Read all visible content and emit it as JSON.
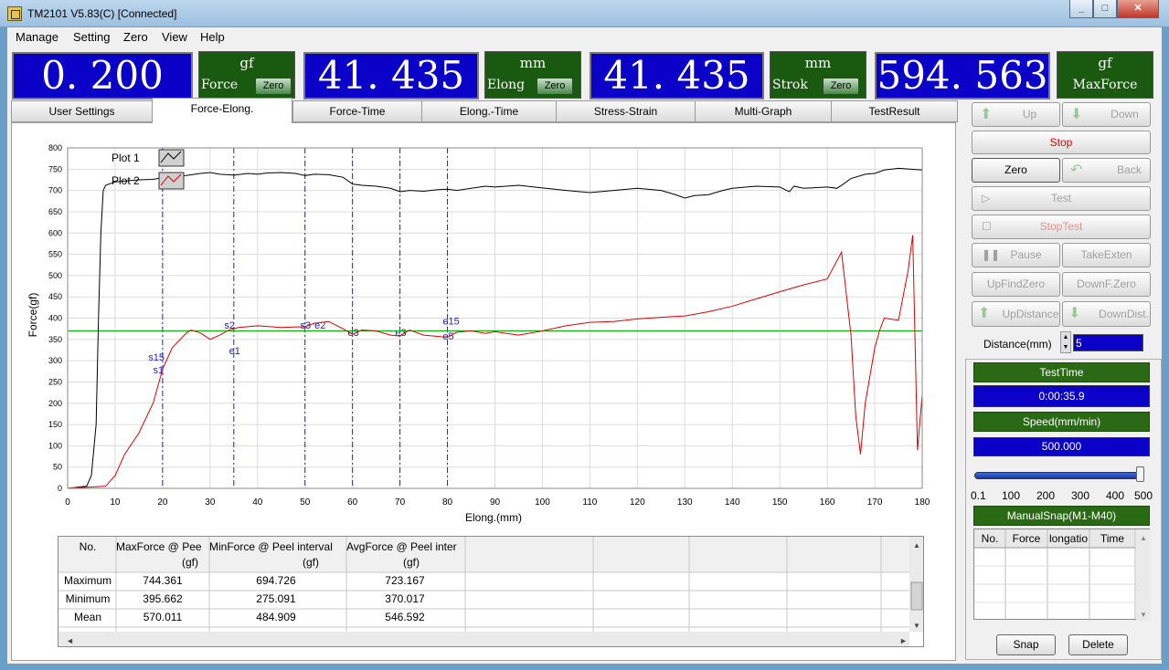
{
  "window": {
    "title": "TM2101  V5.83(C)   [Connected]",
    "min": "_",
    "max": "□",
    "close": "✕"
  },
  "menu": [
    "Manage",
    "Setting",
    "Zero",
    "View",
    "Help"
  ],
  "displays": [
    {
      "value": "0. 200",
      "unit": "gf",
      "label": "Force",
      "zero": "Zero"
    },
    {
      "value": "41. 435",
      "unit": "mm",
      "label": "Elong",
      "zero": "Zero"
    },
    {
      "value": "41. 435",
      "unit": "mm",
      "label": "Strok",
      "zero": "Zero"
    },
    {
      "value": "594. 563",
      "unit": "gf",
      "label": "MaxForce"
    }
  ],
  "tabs": [
    "User Settings",
    "Force-Elong.",
    "Force-Time",
    "Elong.-Time",
    "Stress-Strain",
    "Multi-Graph",
    "TestResult"
  ],
  "active_tab": 1,
  "chart_data": {
    "type": "line",
    "xlabel": "Elong.(mm)",
    "ylabel": "Force(gf)",
    "xlim": [
      0,
      180
    ],
    "ylim": [
      0,
      800
    ],
    "xticks": [
      0,
      10,
      20,
      30,
      40,
      50,
      60,
      70,
      80,
      90,
      100,
      110,
      120,
      130,
      140,
      150,
      160,
      170,
      180
    ],
    "yticks": [
      0,
      50,
      100,
      150,
      200,
      250,
      300,
      350,
      400,
      450,
      500,
      550,
      600,
      650,
      700,
      750,
      800
    ],
    "grid": true,
    "legend": "top-left",
    "series": [
      {
        "name": "Plot 1",
        "color": "#000000",
        "x": [
          0,
          4,
          5,
          6,
          6.5,
          7,
          7.5,
          8,
          9,
          10,
          12,
          15,
          18,
          20,
          22,
          25,
          28,
          30,
          32,
          35,
          38,
          40,
          42,
          45,
          48,
          50,
          52,
          55,
          58,
          60,
          62,
          65,
          68,
          70,
          72,
          75,
          78,
          80,
          82,
          85,
          88,
          90,
          95,
          100,
          105,
          110,
          115,
          120,
          125,
          128,
          130,
          132,
          135,
          138,
          140,
          145,
          150,
          152,
          153,
          155,
          160,
          162,
          163,
          165,
          168,
          170,
          172,
          175,
          180
        ],
        "y": [
          0,
          5,
          30,
          150,
          400,
          600,
          700,
          712,
          716,
          720,
          722,
          725,
          726,
          730,
          734,
          735,
          740,
          742,
          738,
          736,
          740,
          738,
          741,
          742,
          740,
          735,
          738,
          737,
          731,
          715,
          712,
          710,
          705,
          697,
          700,
          698,
          702,
          703,
          700,
          705,
          710,
          708,
          712,
          706,
          700,
          695,
          700,
          705,
          700,
          690,
          682,
          688,
          690,
          700,
          705,
          710,
          708,
          697,
          710,
          705,
          708,
          705,
          712,
          728,
          738,
          740,
          748,
          752,
          748
        ]
      },
      {
        "name": "Plot 2",
        "color": "#e00000",
        "x": [
          0,
          8,
          10,
          12,
          15,
          18,
          20,
          22,
          25,
          26,
          28,
          30,
          32,
          34,
          36,
          38,
          40,
          45,
          50,
          52,
          55,
          58,
          60,
          62,
          65,
          68,
          70,
          72,
          75,
          80,
          82,
          85,
          88,
          90,
          95,
          100,
          105,
          110,
          115,
          120,
          125,
          130,
          135,
          140,
          145,
          150,
          155,
          160,
          163,
          165,
          166,
          167,
          168,
          170,
          171,
          172,
          175,
          177,
          178,
          179,
          180
        ],
        "y": [
          0,
          5,
          30,
          80,
          130,
          200,
          280,
          330,
          365,
          372,
          365,
          350,
          360,
          372,
          378,
          380,
          382,
          378,
          380,
          388,
          392,
          375,
          362,
          372,
          370,
          360,
          358,
          372,
          360,
          355,
          367,
          370,
          364,
          368,
          360,
          370,
          382,
          390,
          392,
          398,
          402,
          405,
          415,
          428,
          445,
          462,
          478,
          492,
          555,
          360,
          170,
          80,
          200,
          330,
          370,
          400,
          395,
          510,
          595,
          90,
          220
        ]
      }
    ],
    "hline": {
      "y": 370,
      "color": "#00b000"
    },
    "vlines": [
      {
        "x": 20,
        "labels": [
          "s15",
          "s1"
        ]
      },
      {
        "x": 35,
        "labels": [
          "s2",
          "e1"
        ]
      },
      {
        "x": 50,
        "labels": [
          "s3",
          "e2"
        ]
      },
      {
        "x": 60,
        "labels": [
          "e3"
        ]
      },
      {
        "x": 70,
        "labels": [
          "e3"
        ]
      },
      {
        "x": 80,
        "labels": [
          "e15",
          "e5"
        ]
      }
    ]
  },
  "results": {
    "headers": [
      {
        "top": "No.",
        "unit": ""
      },
      {
        "top": "MaxForce @ Pee",
        "unit": "(gf)"
      },
      {
        "top": "MinForce @ Peel interval",
        "unit": "(gf)"
      },
      {
        "top": "AvgForce @ Peel inter",
        "unit": "(gf)"
      }
    ],
    "rows": [
      [
        "Maximum",
        "744.361",
        "694.726",
        "723.167"
      ],
      [
        "Minimum",
        "395.662",
        "275.091",
        "370.017"
      ],
      [
        "Mean",
        "570.011",
        "484.909",
        "546.592"
      ]
    ]
  },
  "controls": {
    "up": "Up",
    "down": "Down",
    "stop": "Stop",
    "zero": "Zero",
    "back": "Back",
    "test": "Test",
    "stoptest": "StopTest",
    "pause": "Pause",
    "takeexten": "TakeExten",
    "upfindzero": "UpFindZero",
    "downfzero": "DownF.Zero",
    "updistance": "UpDistance",
    "downdist": "DownDist.",
    "distance_label": "Distance(mm)",
    "distance_value": "5",
    "testtime_label": "TestTime",
    "testtime_value": "0:00:35.9",
    "speed_label": "Speed(mm/min)",
    "speed_value": "500.000",
    "slider_ticks": [
      "0.1",
      "100",
      "200",
      "300",
      "400",
      "500"
    ],
    "slider_value": 500,
    "manualsnap_label": "ManualSnap(M1-M40)",
    "snap_headers": [
      "No.",
      "Force",
      "longatio",
      "Time"
    ],
    "snap": "Snap",
    "delete": "Delete"
  }
}
